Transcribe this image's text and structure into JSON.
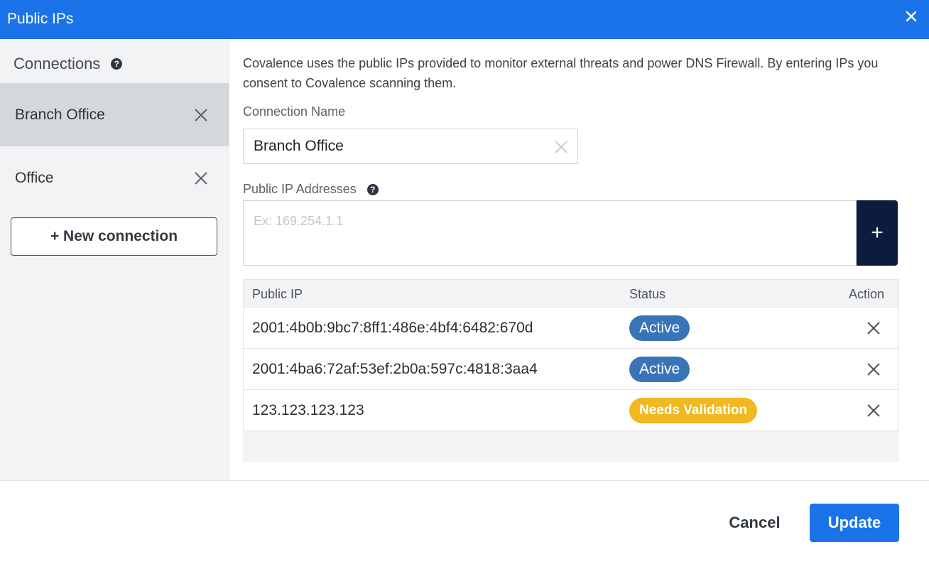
{
  "window": {
    "title": "Public IPs",
    "close_icon": "close-icon"
  },
  "sidebar": {
    "heading": "Connections",
    "help_icon": "?",
    "items": [
      {
        "label": "Branch Office",
        "selected": true
      },
      {
        "label": "Office",
        "selected": false
      }
    ],
    "new_connection_label": "+ New connection"
  },
  "main": {
    "description": "Covalence uses the public IPs provided to monitor external threats and power DNS Firewall. By entering IPs you consent to Covalence scanning them.",
    "connection_name_label": "Connection Name",
    "connection_name_value": "Branch Office",
    "public_ip_label": "Public IP Addresses",
    "public_ip_help": "?",
    "ip_placeholder": "Ex: 169.254.1.1",
    "add_label": "+",
    "table": {
      "columns": [
        "Public IP",
        "Status",
        "Action"
      ],
      "rows": [
        {
          "ip": "2001:4b0b:9bc7:8ff1:486e:4bf4:6482:670d",
          "status": "Active"
        },
        {
          "ip": "2001:4ba6:72af:53ef:2b0a:597c:4818:3aa4",
          "status": "Active"
        },
        {
          "ip": "123.123.123.123",
          "status": "Needs Validation"
        }
      ]
    }
  },
  "footer": {
    "cancel_label": "Cancel",
    "update_label": "Update"
  },
  "colors": {
    "header": "#1a73e8",
    "add_button": "#0c1b3e",
    "active_badge": "#3a74b8",
    "warning_badge": "#f1b820"
  }
}
